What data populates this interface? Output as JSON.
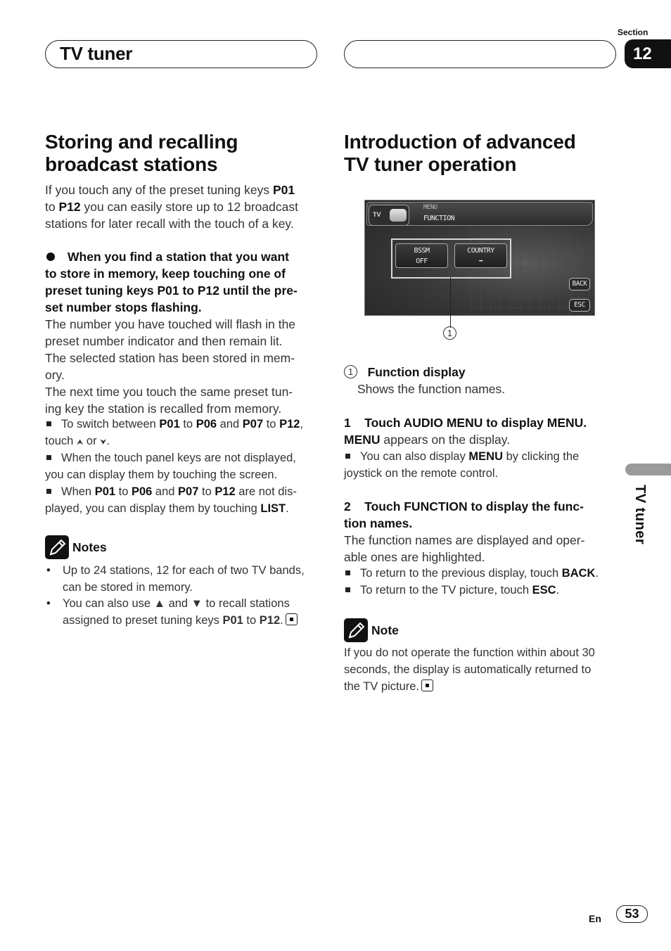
{
  "header": {
    "chapter_title": "TV tuner",
    "section_label": "Section",
    "section_number": "12"
  },
  "left": {
    "heading_line1": "Storing and recalling",
    "heading_line2": "broadcast stations",
    "intro": [
      {
        "pre": "If you touch any of the preset tuning keys ",
        "b1": "P01"
      },
      {
        "pre": "to ",
        "b1": "P12",
        "post": " you can easily store up to 12 broadcast"
      },
      {
        "pre": "stations for later recall with the touch of a key."
      }
    ],
    "step_heading": [
      "When you find a station that you want",
      "to store in memory, keep touching one of",
      "preset tuning keys P01 to P12 until the pre-",
      "set number stops flashing."
    ],
    "step_body": [
      "The number you have touched will flash in the",
      "preset number indicator and then remain lit.",
      "The selected station has been stored in mem-",
      "ory.",
      "The next time you touch the same preset tun-",
      "ing key the station is recalled from memory."
    ],
    "tips": {
      "t1_a": "To switch between ",
      "t1_b1": "P01",
      "t1_c": " to ",
      "t1_b2": "P06",
      "t1_d": " and ",
      "t1_b3": "P07",
      "t1_e": " to ",
      "t1_b4": "P12",
      "t1_f": ",",
      "t1_line2_a": "touch ",
      "t1_up_icon": "⏶⏶",
      "t1_line2_b": " or ",
      "t1_down_icon": "⏷⏷",
      "t1_line2_c": ".",
      "t2_line1": "When the touch panel keys are not displayed,",
      "t2_line2": "you can display them by touching the screen.",
      "t3_a": "When ",
      "t3_b1": "P01",
      "t3_c": " to ",
      "t3_b2": "P06",
      "t3_d": " and ",
      "t3_b3": "P07",
      "t3_e": " to ",
      "t3_b4": "P12",
      "t3_f": " are not dis-",
      "t3_line2_a": "played, you can display them by touching ",
      "t3_line2_b": "LIST",
      "t3_line2_c": "."
    },
    "notes_title": "Notes",
    "notes": {
      "n1_line1": "Up to 24 stations, 12 for each of two TV bands,",
      "n1_line2": "can be stored in memory.",
      "n2_line1": "You can also use ▲ and ▼ to recall stations",
      "n2_line2_a": "assigned to preset tuning keys ",
      "n2_b1": "P01",
      "n2_c": " to ",
      "n2_b2": "P12",
      "n2_d": "."
    }
  },
  "right": {
    "heading_line1": "Introduction of advanced",
    "heading_line2": "TV tuner operation",
    "screen": {
      "tv_label": "TV",
      "menu_label": "MENU",
      "function_label": "FUNCTION",
      "bssm_label": "BSSM",
      "bssm_value": "OFF",
      "country_label": "COUNTRY",
      "country_value": "➡",
      "back_label": "BACK",
      "esc_label": "ESC"
    },
    "callout_number": "1",
    "legend_number": "1",
    "legend_title": "Function display",
    "legend_desc": "Shows the function names.",
    "step1_num": "1",
    "step1_title": "Touch AUDIO MENU to display MENU.",
    "step1_body_b": "MENU",
    "step1_body": " appears on the display.",
    "step1_tip_a": "You can also display ",
    "step1_tip_b": "MENU",
    "step1_tip_c": " by clicking the",
    "step1_tip_line2": "joystick on the remote control.",
    "step2_num": "2",
    "step2_title_line1": "Touch FUNCTION to display the func-",
    "step2_title_line2": "tion names.",
    "step2_body_line1": "The function names are displayed and oper-",
    "step2_body_line2": "able ones are highlighted.",
    "step2_tip1_a": "To return to the previous display, touch ",
    "step2_tip1_b": "BACK",
    "step2_tip1_c": ".",
    "step2_tip2_a": "To return to the TV picture, touch ",
    "step2_tip2_b": "ESC",
    "step2_tip2_c": ".",
    "note_title": "Note",
    "note_line1": "If you do not operate the function within about 30",
    "note_line2": "seconds, the display is automatically returned to",
    "note_line3": "the TV picture."
  },
  "side_tab_label": "TV tuner",
  "footer": {
    "language": "En",
    "page_number": "53"
  }
}
